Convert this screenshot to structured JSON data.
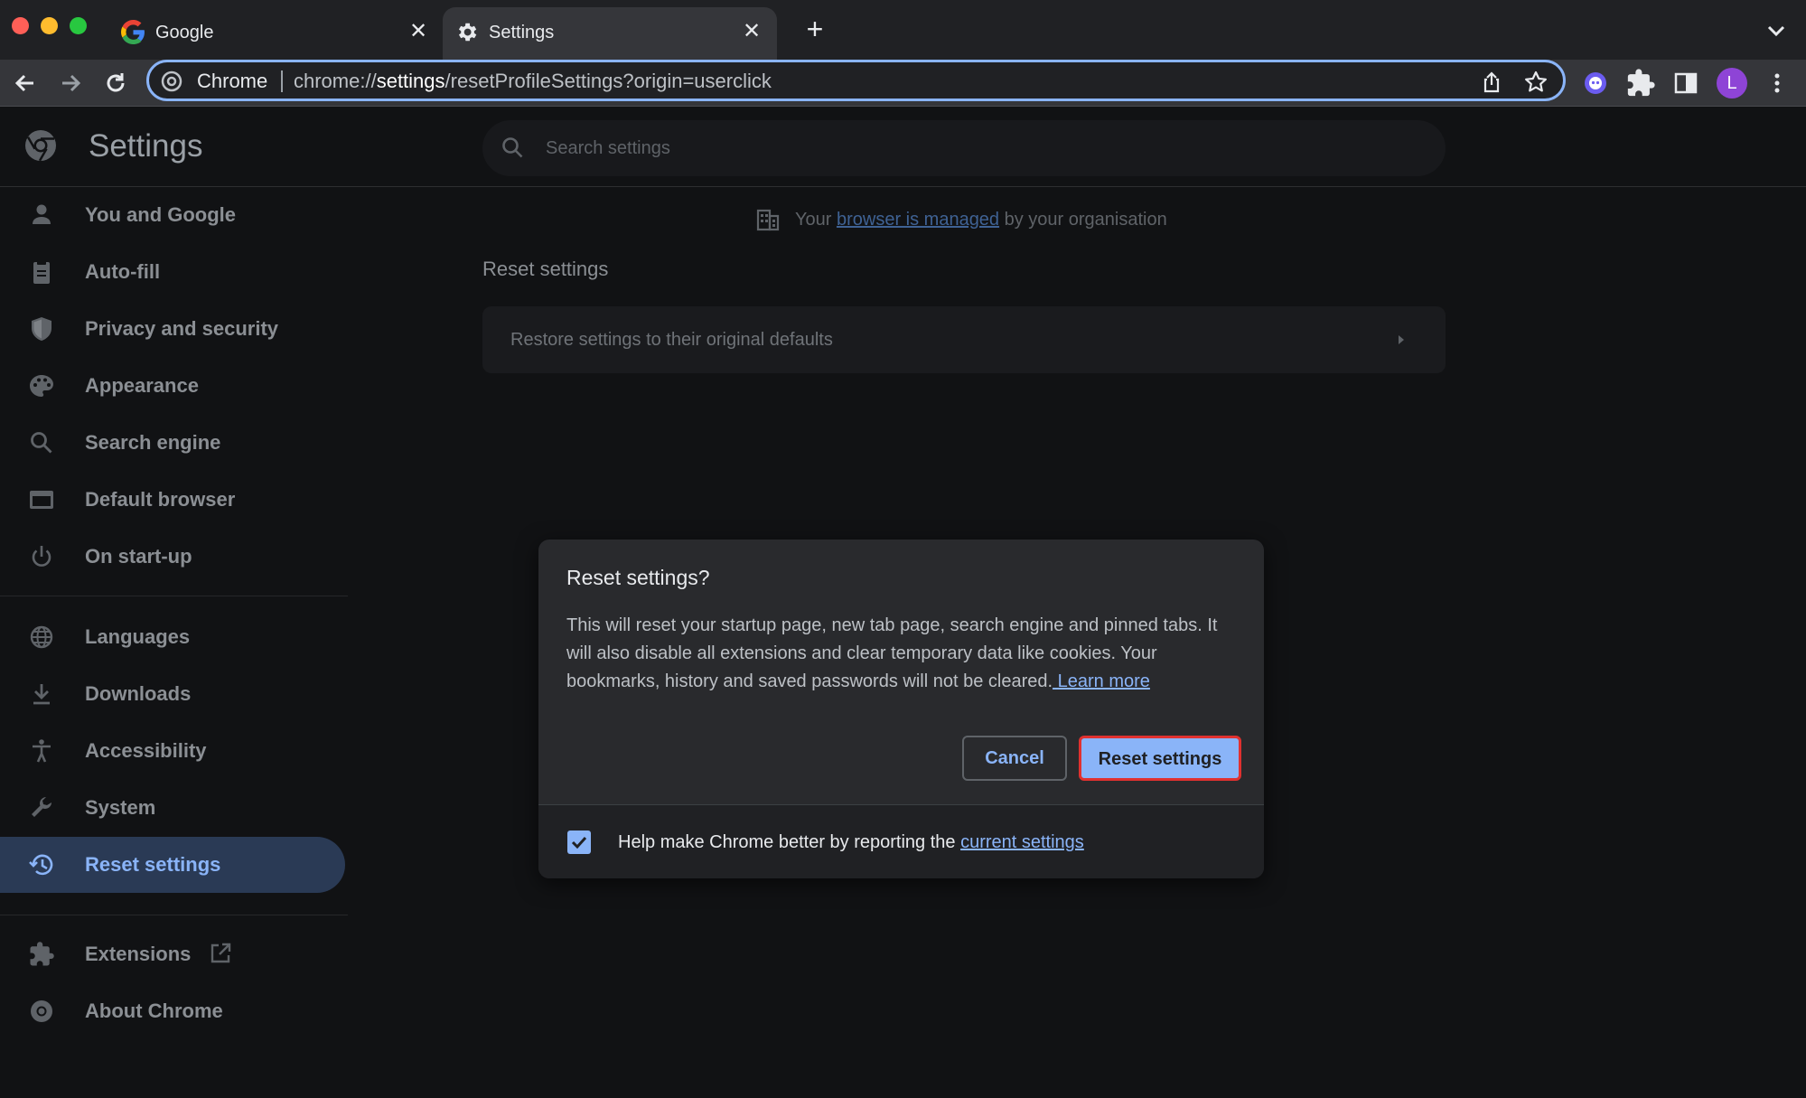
{
  "window": {
    "tabs": [
      {
        "title": "Google",
        "favicon": "google-g-icon",
        "active": false
      },
      {
        "title": "Settings",
        "favicon": "gear-icon",
        "active": true
      }
    ],
    "close_glyph": "✕",
    "new_tab_glyph": "+"
  },
  "omnibox": {
    "origin_label": "Chrome",
    "url_prefix": "chrome://",
    "url_host": "settings",
    "url_path": "/resetProfileSettings?origin=userclick"
  },
  "profile": {
    "initial": "L",
    "color": "#8e44d6"
  },
  "settings": {
    "page_title": "Settings",
    "search_placeholder": "Search settings",
    "nav": [
      {
        "label": "You and Google",
        "icon": "person-icon"
      },
      {
        "label": "Auto-fill",
        "icon": "clipboard-icon"
      },
      {
        "label": "Privacy and security",
        "icon": "shield-icon"
      },
      {
        "label": "Appearance",
        "icon": "palette-icon"
      },
      {
        "label": "Search engine",
        "icon": "search-icon"
      },
      {
        "label": "Default browser",
        "icon": "browser-icon"
      },
      {
        "label": "On start-up",
        "icon": "power-icon"
      },
      {
        "label": "Languages",
        "icon": "globe-icon"
      },
      {
        "label": "Downloads",
        "icon": "download-icon"
      },
      {
        "label": "Accessibility",
        "icon": "accessibility-icon"
      },
      {
        "label": "System",
        "icon": "wrench-icon"
      },
      {
        "label": "Reset settings",
        "icon": "history-icon",
        "active": true
      },
      {
        "label": "Extensions",
        "icon": "puzzle-icon"
      },
      {
        "label": "About Chrome",
        "icon": "chrome-icon"
      }
    ],
    "managed_notice": {
      "prefix": "Your ",
      "link": "browser is managed",
      "suffix": " by your organisation"
    },
    "section_title": "Reset settings",
    "restore_row": "Restore settings to their original defaults"
  },
  "dialog": {
    "title": "Reset settings?",
    "body": "This will reset your startup page, new tab page, search engine and pinned tabs. It will also disable all extensions and clear temporary data like cookies. Your bookmarks, history and saved passwords will not be cleared.",
    "learn_more": " Learn more",
    "cancel_label": "Cancel",
    "reset_label": "Reset settings",
    "checkbox_checked": true,
    "checkbox_label": "Help make Chrome better by reporting the ",
    "checkbox_link": "current settings"
  },
  "colors": {
    "accent": "#8ab4f8",
    "highlight_border": "#e0312f"
  }
}
